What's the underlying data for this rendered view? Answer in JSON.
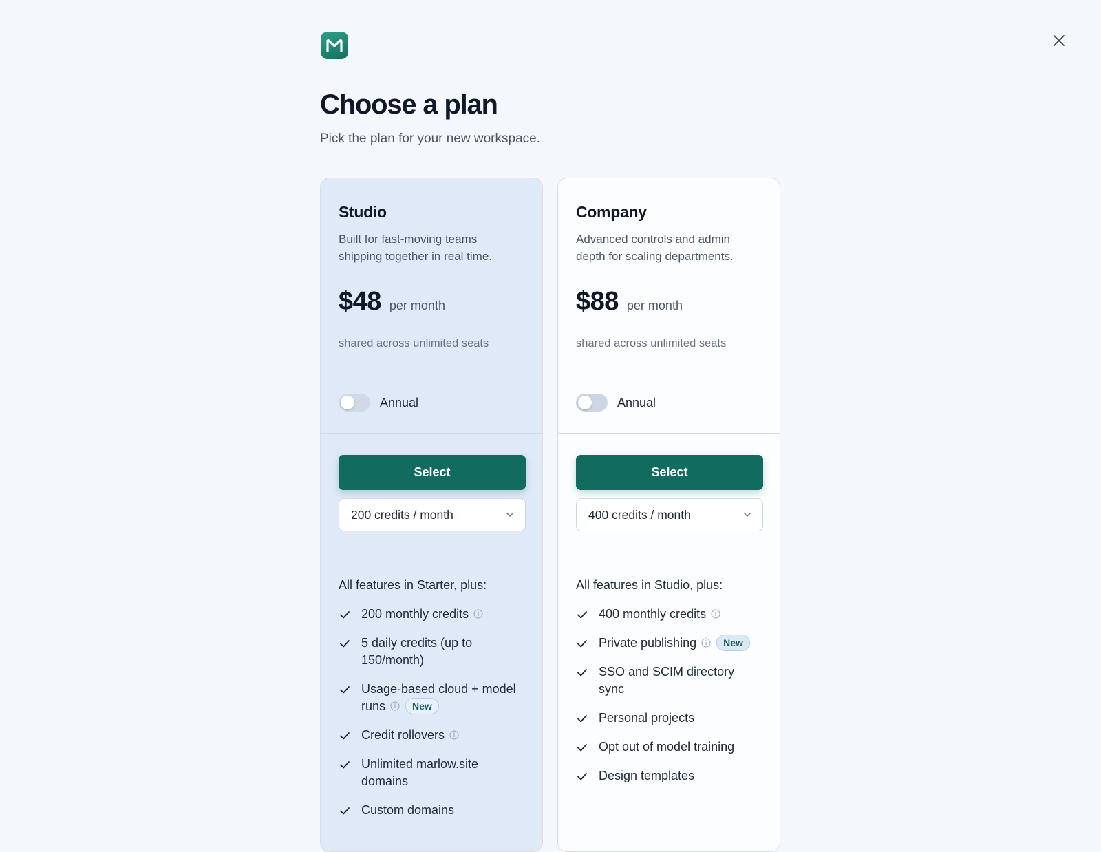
{
  "header": {
    "logo_letter": "M",
    "title": "Choose a plan",
    "subtitle": "Pick the plan for your new workspace."
  },
  "icons": {
    "close": "close-icon",
    "logo": "logo-icon",
    "check": "check-icon",
    "info": "info-icon",
    "chevron": "chevron-down-icon"
  },
  "colors": {
    "accent": "#116b5f",
    "studio_card_bg": "#dfe9f7",
    "company_card_bg": "#fbfdff",
    "page_bg": "#f4f7fb"
  },
  "plans": [
    {
      "name": "Studio",
      "description": "Built for fast-moving teams shipping together in real time.",
      "price": "$48",
      "period": "per month",
      "seats_note": "shared across unlimited seats",
      "annual_label": "Annual",
      "annual_on": false,
      "select_label": "Select",
      "credits_value": "200 credits / month",
      "features_heading": "All features in Starter, plus:",
      "features": [
        {
          "text": "200 monthly credits",
          "info": true,
          "badge": ""
        },
        {
          "text": "5 daily credits (up to 150/month)",
          "info": false,
          "badge": ""
        },
        {
          "text": "Usage-based cloud + model runs",
          "info": true,
          "badge": "New"
        },
        {
          "text": "Credit rollovers",
          "info": true,
          "badge": ""
        },
        {
          "text": "Unlimited marlow.site domains",
          "info": false,
          "badge": ""
        },
        {
          "text": "Custom domains",
          "info": false,
          "badge": ""
        }
      ]
    },
    {
      "name": "Company",
      "description": "Advanced controls and admin depth for scaling departments.",
      "price": "$88",
      "period": "per month",
      "seats_note": "shared across unlimited seats",
      "annual_label": "Annual",
      "annual_on": false,
      "select_label": "Select",
      "credits_value": "400 credits / month",
      "features_heading": "All features in Studio, plus:",
      "features": [
        {
          "text": "400 monthly credits",
          "info": true,
          "badge": ""
        },
        {
          "text": "Private publishing",
          "info": true,
          "badge": "New"
        },
        {
          "text": "SSO and SCIM directory sync",
          "info": false,
          "badge": ""
        },
        {
          "text": "Personal projects",
          "info": false,
          "badge": ""
        },
        {
          "text": "Opt out of model training",
          "info": false,
          "badge": ""
        },
        {
          "text": "Design templates",
          "info": false,
          "badge": ""
        }
      ]
    }
  ]
}
